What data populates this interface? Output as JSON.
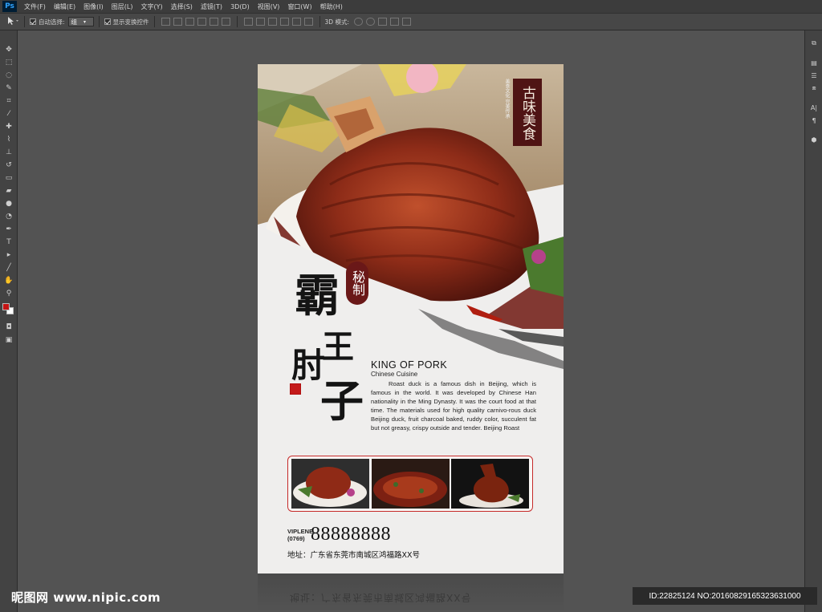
{
  "app": {
    "logo": "Ps"
  },
  "menu": [
    "文件(F)",
    "编辑(E)",
    "图像(I)",
    "图层(L)",
    "文字(Y)",
    "选择(S)",
    "滤镜(T)",
    "3D(D)",
    "视图(V)",
    "窗口(W)",
    "帮助(H)"
  ],
  "options": {
    "auto_select_label": "自动选择:",
    "auto_select_value": "组",
    "show_transform_label": "显示变换控件",
    "mode_3d_label": "3D 模式:"
  },
  "poster": {
    "seal_text": "古味美食",
    "vertical_small": "美食文化 完美传承",
    "secret_badge": "秘制",
    "cal_1": "霸",
    "cal_2": "王",
    "cal_3": "肘",
    "cal_4": "子",
    "english_title": "KING OF PORK",
    "english_sub": "Chinese  Cuisine",
    "description": "Roast duck is a famous dish in Beijing, which is famous in the world. It was developed by Chinese Han nationality in the Ming Dynasty. It was the court food at that time. The materials used for high quality carnivo-rous duck Beijing duck, fruit charcoal baked, ruddy color, succulent fat but not greasy, crispy outside and tender. Beijing Roast",
    "phone_label_1": "VIPLENE",
    "phone_label_2": "(0769)",
    "phone_number": "88888888",
    "address": "地址：广东省东莞市南城区鸿福路XX号"
  },
  "reflection_text": "地址：广东省东莞市南城区鸿福路XX号",
  "watermark": {
    "site": "昵图网 www.nipic.com",
    "id_line": "ID:22825124 NO:20160829165323631000"
  }
}
